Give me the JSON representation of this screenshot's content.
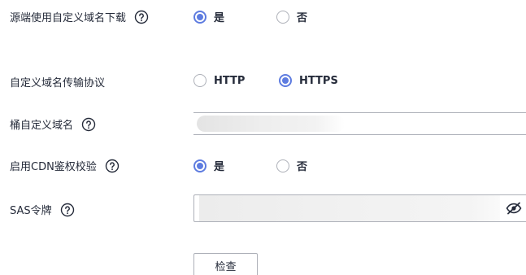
{
  "form": {
    "source_custom_domain_download": {
      "label": "源端使用自定义域名下载",
      "options": [
        {
          "label": "是",
          "checked": true
        },
        {
          "label": "否",
          "checked": false
        }
      ]
    },
    "custom_domain_protocol": {
      "label": "自定义域名传输协议",
      "options": [
        {
          "label": "HTTP",
          "checked": false
        },
        {
          "label": "HTTPS",
          "checked": true
        }
      ]
    },
    "bucket_custom_domain": {
      "label": "桶自定义域名",
      "value": ""
    },
    "enable_cdn_auth": {
      "label": "启用CDN鉴权校验",
      "options": [
        {
          "label": "是",
          "checked": true
        },
        {
          "label": "否",
          "checked": false
        }
      ]
    },
    "sas_token": {
      "label": "SAS令牌",
      "value": ""
    },
    "check_button_label": "检查"
  },
  "icons": {
    "help": "help-circle-icon",
    "eye_off": "eye-off-icon"
  },
  "colors": {
    "accent": "#5e7ce0",
    "text": "#252b3a",
    "border": "#adb0b8"
  }
}
